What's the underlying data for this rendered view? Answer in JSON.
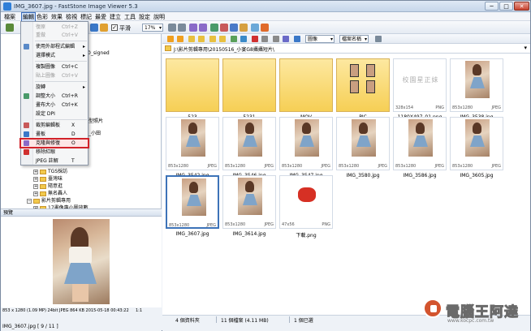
{
  "titlebar": {
    "title": "IMG_3607.jpg - FastStone Image Viewer 5.3",
    "min": "─",
    "max": "□",
    "close": "✕"
  },
  "menubar": {
    "items": [
      "檔案",
      "編輯",
      "色彩",
      "效果",
      "檢視",
      "標記",
      "最愛",
      "建立",
      "工具",
      "設定",
      "說明"
    ]
  },
  "toolbar": {
    "smooth_label": "平滑",
    "smooth_checked": true,
    "zoom": "17%"
  },
  "navbar": {
    "view_mode": "圖像",
    "sort": "檔案名稱"
  },
  "path": "J:\\影片剪輯專用\\20150516_小宴G8攝攝短片\\",
  "edit_menu": {
    "items": [
      {
        "label": "復原",
        "shortcut": "Ctrl+Z",
        "disabled": true
      },
      {
        "label": "重做",
        "shortcut": "Ctrl+V",
        "disabled": true
      },
      {
        "label": "使用外部程式編輯",
        "shortcut": "",
        "submenu": true
      },
      {
        "label": "選擇模式",
        "shortcut": "",
        "submenu": true
      },
      {
        "label": "複製圖像",
        "shortcut": "Ctrl+C"
      },
      {
        "label": "貼上圖像",
        "shortcut": "Ctrl+V",
        "disabled": true
      },
      {
        "label": "旋轉",
        "shortcut": "",
        "submenu": true
      },
      {
        "label": "調整大小",
        "shortcut": "Ctrl+R"
      },
      {
        "label": "畫布大小",
        "shortcut": "Ctrl+K"
      },
      {
        "label": "設定 DPI",
        "shortcut": ""
      },
      {
        "label": "裁剪編輯板",
        "shortcut": "X"
      },
      {
        "label": "畫板",
        "shortcut": "D"
      },
      {
        "label": "克隆與修復",
        "shortcut": "O"
      },
      {
        "label": "移除紅眼",
        "shortcut": ""
      },
      {
        "label": "JPEG 註解",
        "shortcut": "T"
      }
    ]
  },
  "tree": {
    "items": [
      {
        "label": "_0_signed"
      },
      {
        "label": "TGS採訪"
      },
      {
        "label": "臺灣味"
      },
      {
        "label": "隨意逛"
      },
      {
        "label": "無名轟人"
      },
      {
        "label": "影片剪輯專用"
      },
      {
        "label": "17畫像專小圖放數"
      }
    ],
    "side_notes": [
      "翻型照片",
      "女_小田"
    ]
  },
  "preview": {
    "header": "預覽",
    "info": "853 x 1280 (1.09 MP)  24bit  JPEG  864 KB  2015-05-18 00:43:22",
    "zoom_info": "1:1",
    "file_status": "IMG_3607.jpg [ 9 / 11 ]"
  },
  "thumbnails": [
    {
      "name": "523",
      "type": "folder"
    },
    {
      "name": "5231",
      "type": "folder"
    },
    {
      "name": "MOV",
      "type": "folder"
    },
    {
      "name": "PIC",
      "type": "pic-folder"
    },
    {
      "name": "1180X497_01.png",
      "type": "watermark",
      "dims": "328x154",
      "fmt": "PNG",
      "watermark_text": "校園星正妹"
    },
    {
      "name": "IMG_3538.jpg",
      "type": "photo",
      "dims": "853x1280",
      "fmt": "JPEG"
    },
    {
      "name": "IMG_3542.jpg",
      "type": "photo",
      "dims": "853x1280",
      "fmt": "JPEG"
    },
    {
      "name": "IMG_3546.jpg",
      "type": "photo",
      "dims": "853x1280",
      "fmt": "JPEG"
    },
    {
      "name": "IMG_3547.jpg",
      "type": "photo",
      "dims": "853x1280",
      "fmt": "JPEG"
    },
    {
      "name": "IMG_3580.jpg",
      "type": "photo",
      "dims": "853x1280",
      "fmt": "JPEG"
    },
    {
      "name": "IMG_3586.jpg",
      "type": "photo",
      "dims": "853x1280",
      "fmt": "JPEG"
    },
    {
      "name": "IMG_3605.jpg",
      "type": "photo",
      "dims": "853x1280",
      "fmt": "JPEG"
    },
    {
      "name": "IMG_3607.jpg",
      "type": "photo",
      "dims": "853x1280",
      "fmt": "JPEG",
      "selected": true
    },
    {
      "name": "IMG_3614.jpg",
      "type": "photo",
      "dims": "853x1280",
      "fmt": "JPEG"
    },
    {
      "name": "下載.png",
      "type": "red",
      "dims": "47x56",
      "fmt": "PNG"
    }
  ],
  "statusbar": {
    "dirs": "4 個資料夾",
    "files": "11 個檔案 (4.11 MB)",
    "selected": "1 個已選"
  },
  "logo": {
    "text": "電腦王阿達",
    "url": "www.kocpc.com.tw"
  },
  "colors": {
    "selection": "#3d73b8",
    "highlight_box": "#d2232a",
    "folder": "#f6cf55"
  }
}
